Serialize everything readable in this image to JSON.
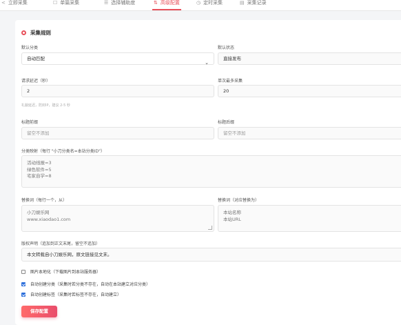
{
  "tabs": [
    {
      "label": "立即采集",
      "icon": "share-icon"
    },
    {
      "label": "单篇采集",
      "icon": "edit-icon"
    },
    {
      "label": "选择辅助度",
      "icon": "list-icon"
    },
    {
      "label": "高级配置",
      "icon": "settings-icon",
      "active": true
    },
    {
      "label": "定时采集",
      "icon": "clock-icon"
    },
    {
      "label": "采集记录",
      "icon": "document-icon"
    }
  ],
  "panel_title": "采集规则",
  "category": {
    "label": "默认分类",
    "value": "自动匹配",
    "option_arrow": "⌄"
  },
  "status": {
    "label": "默认状态",
    "value": "直接发布"
  },
  "delay": {
    "label": "请求延迟（秒）",
    "value": "2",
    "hint": "礼貌延迟，防封IP，建议 2-5 秒"
  },
  "max_per_run": {
    "label": "单次最多采集",
    "value": "20"
  },
  "title_prefix": {
    "label": "标题前缀",
    "placeholder": "留空不添加"
  },
  "title_suffix": {
    "label": "标题后缀",
    "placeholder": "留空不添加"
  },
  "category_map": {
    "label": "分类映射（每行 \"小刀分类名=本站分类ID\"）",
    "lines": [
      "活动线报=3",
      "绿色软件=5",
      "宅家自学=8"
    ]
  },
  "replace_from": {
    "label": "替换词（每行一个，从）",
    "lines": [
      "小刀娱乐网",
      "www.xiaodao1.com"
    ]
  },
  "replace_to": {
    "label": "替换词（对应替换为）",
    "lines": [
      "本站名称",
      "本站URL"
    ]
  },
  "copyright": {
    "label": "版权声明（追加到正文末尾，留空不追加）",
    "value": "本文转载自小刀娱乐网，原文链接见文末。"
  },
  "options": [
    {
      "label": "图片本地化（下载图片到本站服务器）",
      "checked": false
    },
    {
      "label": "自动创建分类（采集时若分类不存在，自动在本站建立对应分类）",
      "checked": true
    },
    {
      "label": "自动创建标签（采集时若标签不存在，自动建立）",
      "checked": true
    }
  ],
  "save_label": "保存配置",
  "accent_color": "#e8505b"
}
